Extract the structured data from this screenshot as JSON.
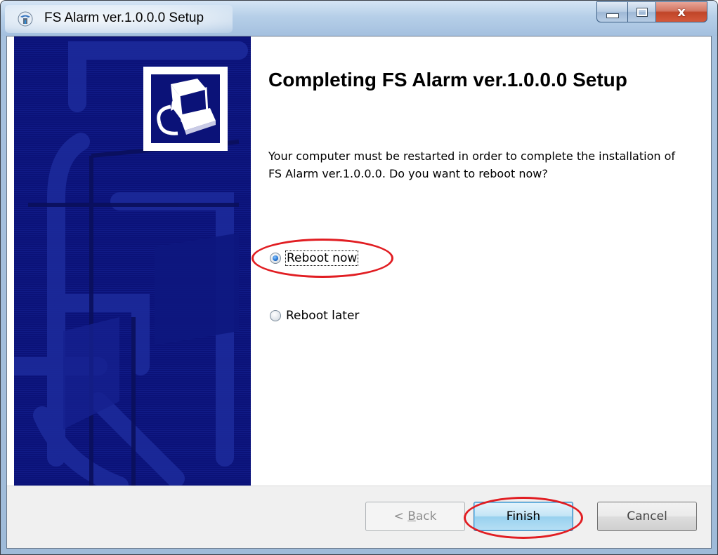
{
  "window": {
    "title": "FS Alarm ver.1.0.0.0 Setup",
    "caption_close": "x"
  },
  "wizard": {
    "heading": "Completing FS Alarm ver.1.0.0.0 Setup",
    "description": "Your computer must be restarted in order to complete the installation of FS Alarm ver.1.0.0.0. Do you want to reboot now?",
    "options": [
      {
        "label": "Reboot now",
        "checked": true
      },
      {
        "label": "Reboot later",
        "checked": false
      }
    ]
  },
  "buttons": {
    "back_prefix": "< ",
    "back_accel": "B",
    "back_rest": "ack",
    "finish": "Finish",
    "cancel": "Cancel"
  },
  "colors": {
    "banner": "#0b1278",
    "highlight": "#e11d22"
  }
}
